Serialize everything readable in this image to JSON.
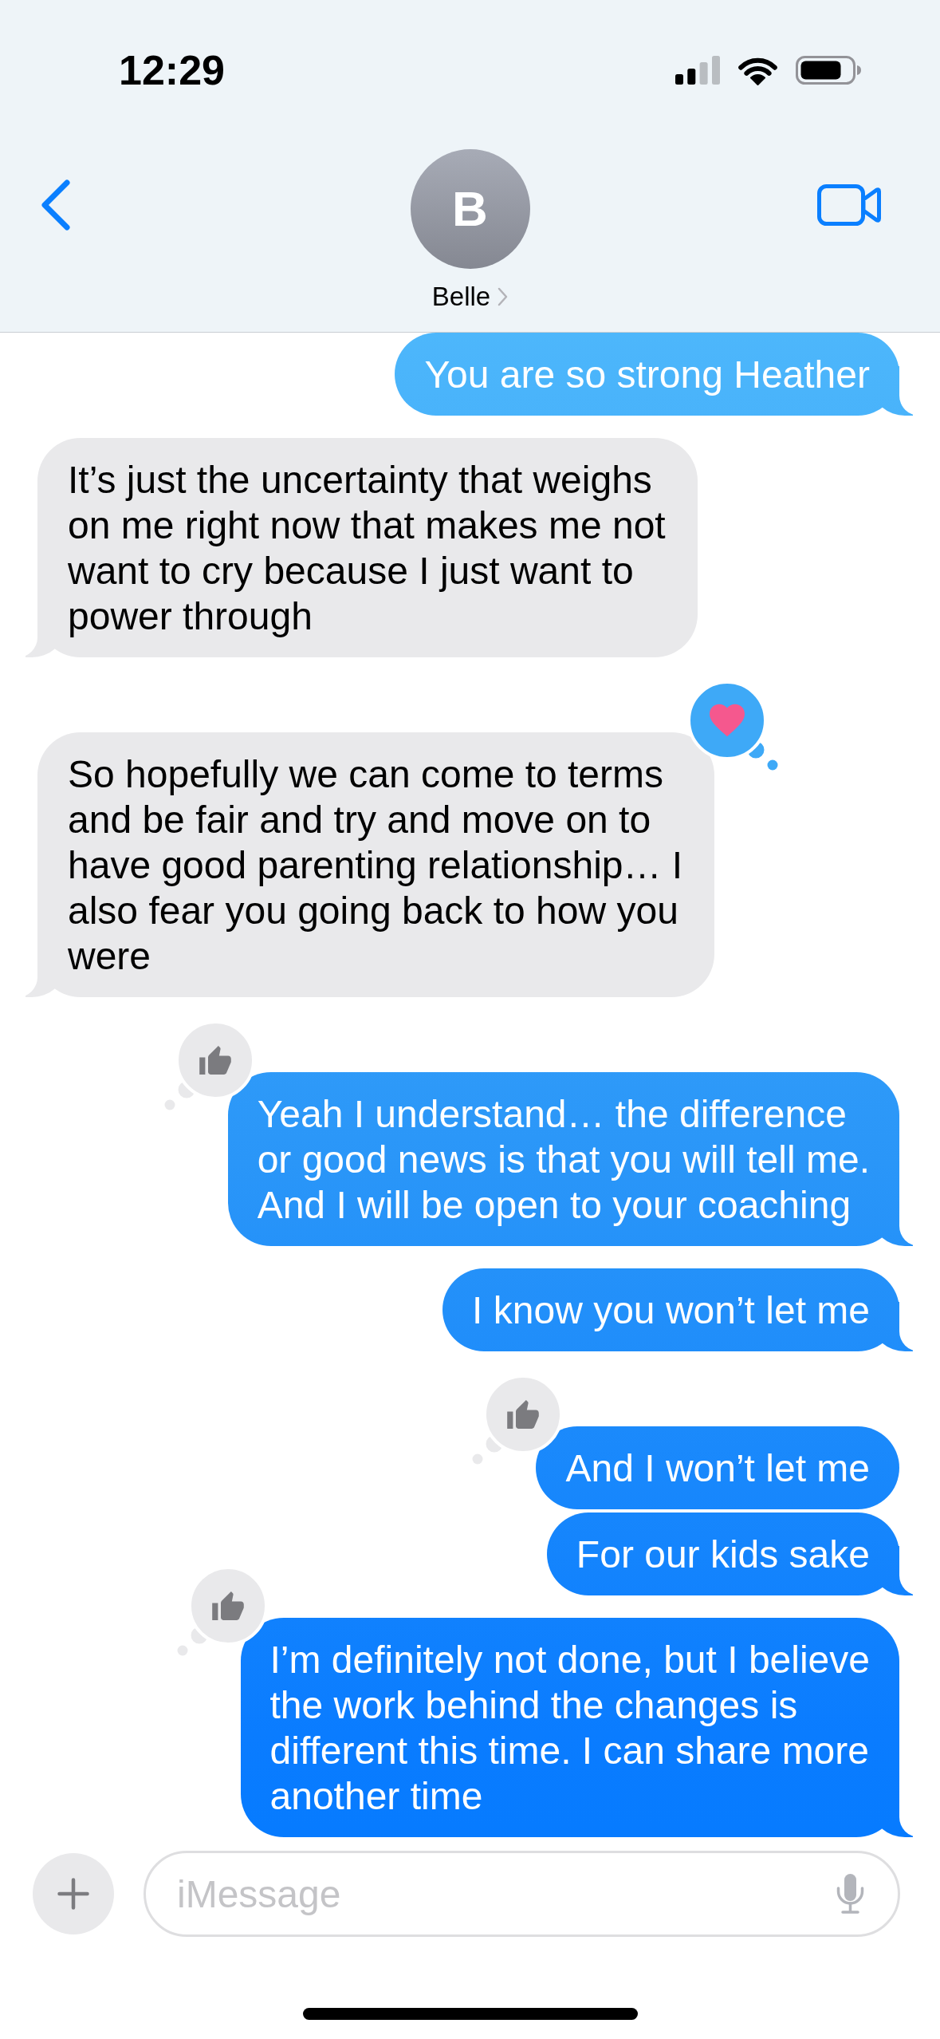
{
  "status_bar": {
    "time": "12:29"
  },
  "header": {
    "avatar_initial": "B",
    "contact_name": "Belle"
  },
  "messages": [
    {
      "kind": "sent",
      "text": "You are so strong Heather",
      "tail": true
    },
    {
      "kind": "received",
      "text": "It’s just the uncertainty that weighs\non me right now that makes me not\nwant to cry because I just want to\npower through",
      "tail": true
    },
    {
      "kind": "received",
      "text": "So hopefully we can come to terms\nand be fair and try and move on to\nhave good parenting relationship… I\nalso fear you going back to how you\nwere",
      "tail": true,
      "reaction": {
        "kind": "heart",
        "mine": true
      }
    },
    {
      "kind": "sent",
      "text": "Yeah I understand… the difference\nor good news is that you will tell me.\nAnd I will be open to your coaching",
      "tail": true,
      "reaction": {
        "kind": "thumbs_up",
        "mine": false
      }
    },
    {
      "kind": "sent",
      "text": "I know you won’t let me",
      "tail": true
    },
    {
      "kind": "sent",
      "text": "And I won’t let me",
      "tail": false,
      "reaction": {
        "kind": "thumbs_up",
        "mine": false
      }
    },
    {
      "kind": "sent",
      "text": "For our kids sake",
      "tail": true
    },
    {
      "kind": "sent",
      "text": "I’m definitely not done, but I believe\nthe work behind the changes is\ndifferent this time. I can share more\nanother time",
      "tail": true,
      "reaction": {
        "kind": "thumbs_up",
        "mine": false
      }
    }
  ],
  "composer": {
    "placeholder": "iMessage"
  }
}
